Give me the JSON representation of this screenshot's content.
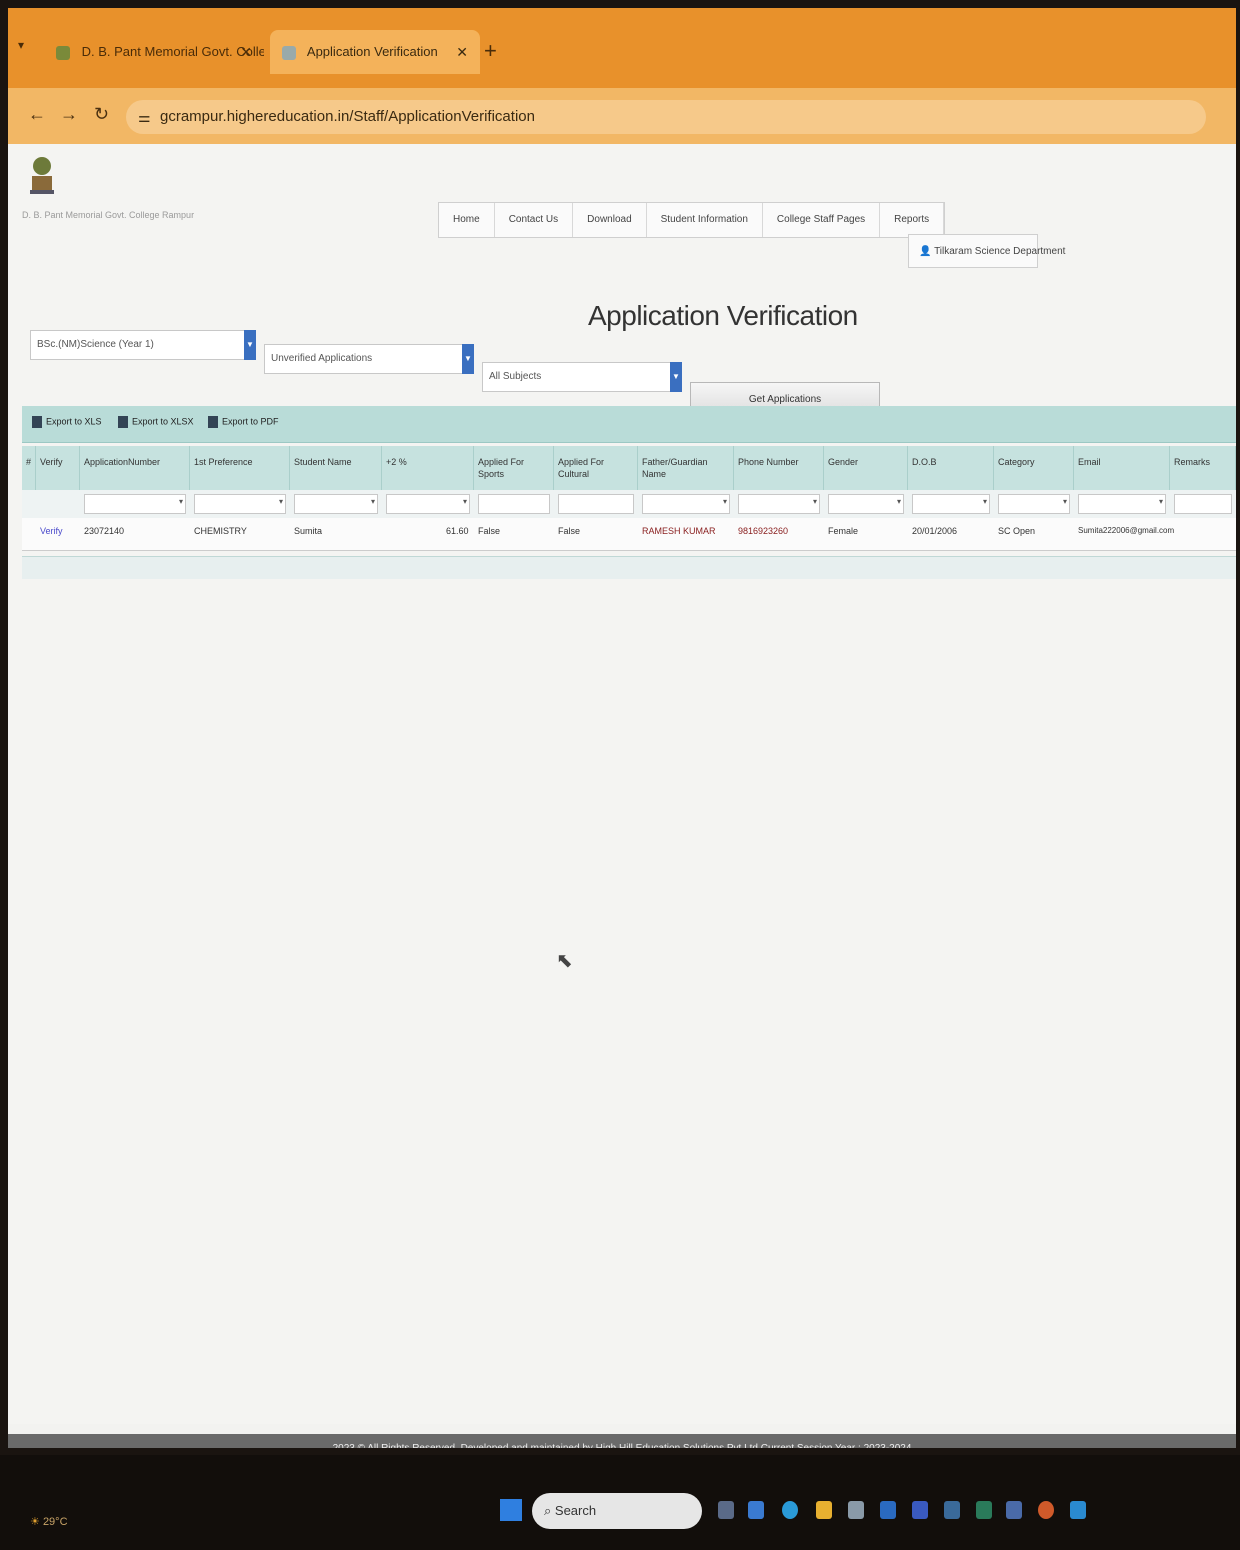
{
  "browser": {
    "tabs": [
      {
        "label": "D. B. Pant Memorial Govt. Colle",
        "active": false
      },
      {
        "label": "Application Verification",
        "active": true
      }
    ],
    "url": "gcrampur.highereducation.in/Staff/ApplicationVerification"
  },
  "header": {
    "college_name": "D. B. Pant Memorial Govt. College Rampur",
    "menu": [
      "Home",
      "Contact Us",
      "Download",
      "Student Information",
      "College Staff Pages",
      "Reports"
    ],
    "user": "Tilkaram  Science  Department"
  },
  "main": {
    "title": "Application Verification",
    "filters": {
      "course": "BSc.(NM)Science (Year 1)",
      "status": "Unverified Applications",
      "subjects": "All Subjects"
    },
    "get_button": "Get Applications",
    "exports": [
      "Export to XLS",
      "Export to XLSX",
      "Export to PDF"
    ],
    "columns": [
      "#",
      "Verify",
      "ApplicationNumber",
      "1st Preference",
      "Student Name",
      "+2 %",
      "Applied For Sports",
      "Applied For Cultural",
      "Father/Guardian Name",
      "Phone Number",
      "Gender",
      "D.O.B",
      "Category",
      "Email",
      "Remarks"
    ],
    "rows": [
      {
        "verify": "Verify",
        "application_number": "23072140",
        "preference": "CHEMISTRY",
        "student_name": "Sumita",
        "percent": "61.60",
        "sports": "False",
        "cultural": "False",
        "father": "RAMESH KUMAR",
        "phone": "9816923260",
        "gender": "Female",
        "dob": "20/01/2006",
        "category": "SC Open",
        "email": "Sumita222006@gmail.com"
      }
    ]
  },
  "footer": {
    "text": "2023 © All Rights Reserved. Developed and maintained by High Hill Education Solutions Pvt Ltd Current Session Year : 2023-2024"
  },
  "taskbar": {
    "weather": "29°C",
    "search_placeholder": "Search"
  }
}
